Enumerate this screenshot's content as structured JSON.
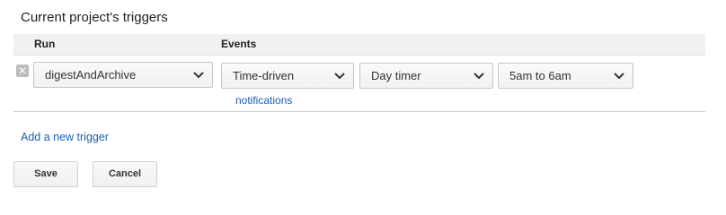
{
  "title": "Current project's triggers",
  "table": {
    "columns": {
      "run": "Run",
      "events": "Events"
    },
    "trigger": {
      "function": "digestAndArchive",
      "event_source": "Time-driven",
      "event_type": "Day timer",
      "time_of_day": "5am to 6am",
      "notifications_link": "notifications"
    }
  },
  "add_trigger_link": "Add a new trigger",
  "buttons": {
    "save": "Save",
    "cancel": "Cancel"
  },
  "colors": {
    "link": "#1a5fb4",
    "header_bg": "#f1f1f1"
  }
}
